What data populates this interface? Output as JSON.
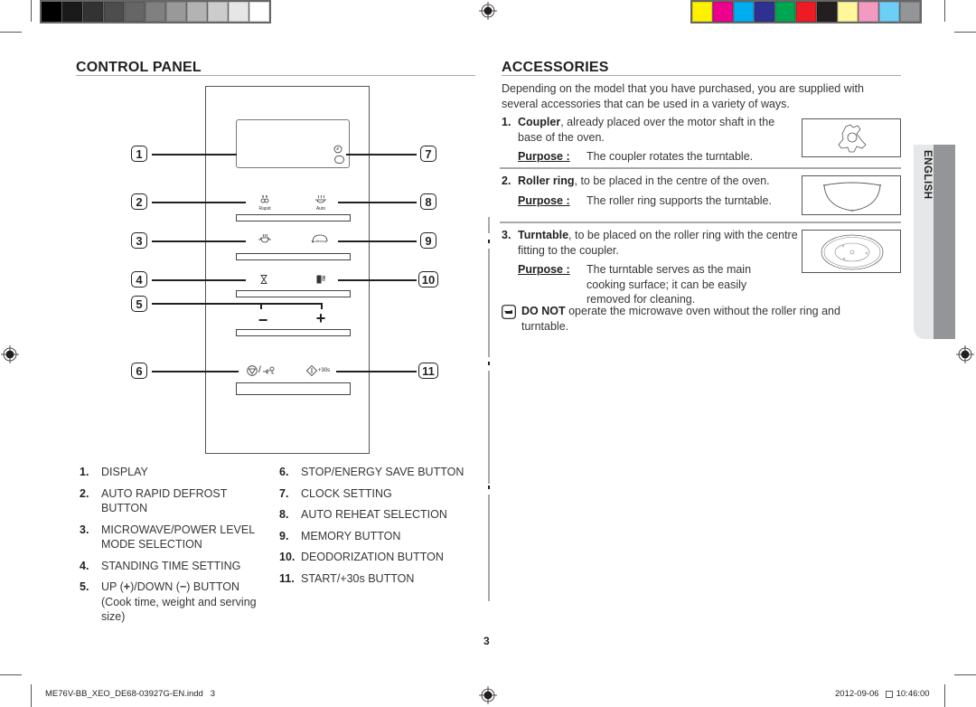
{
  "color_bars": {
    "grayscale": [
      "#000000",
      "#1a1a1a",
      "#333333",
      "#4d4d4d",
      "#666666",
      "#808080",
      "#999999",
      "#b3b3b3",
      "#cccccc",
      "#e6e6e6",
      "#ffffff"
    ],
    "process": [
      "#fff200",
      "#ec008c",
      "#00aeef",
      "#2e3192",
      "#00a651",
      "#ed1c24",
      "#231f20",
      "#fff799",
      "#f49ac1",
      "#6dcff6",
      "#939598"
    ]
  },
  "control_panel": {
    "title": "CONTROL PANEL",
    "callouts": [
      "1",
      "2",
      "3",
      "4",
      "5",
      "6",
      "7",
      "8",
      "9",
      "10",
      "11"
    ],
    "icons": {
      "rapid_label": "Rapid",
      "auto_label": "Auto",
      "memory_label": "Memory",
      "minus": "−",
      "plus": "+",
      "stop_separator": "/",
      "start_label": "+30s"
    },
    "legend_left": [
      {
        "num": "1.",
        "text": "DISPLAY"
      },
      {
        "num": "2.",
        "text": "AUTO RAPID DEFROST BUTTON"
      },
      {
        "num": "3.",
        "text": "MICROWAVE/POWER LEVEL MODE SELECTION"
      },
      {
        "num": "4.",
        "text": "STANDING TIME SETTING"
      },
      {
        "num": "5.",
        "text_before": "UP (",
        "plus": "+",
        "text_mid": ")/DOWN (",
        "minus": "−",
        "text_after": ") BUTTON (Cook time, weight and serving size)"
      }
    ],
    "legend_right": [
      {
        "num": "6.",
        "text": "STOP/ENERGY SAVE BUTTON"
      },
      {
        "num": "7.",
        "text": "CLOCK SETTING"
      },
      {
        "num": "8.",
        "text": "AUTO REHEAT SELECTION"
      },
      {
        "num": "9.",
        "text": "MEMORY BUTTON"
      },
      {
        "num": "10.",
        "text": "DEODORIZATION BUTTON"
      },
      {
        "num": "11.",
        "text": "START/+30s BUTTON"
      }
    ]
  },
  "accessories": {
    "title": "ACCESSORIES",
    "intro": "Depending on the model that you have purchased, you are supplied with several accessories that can be used in a variety of ways.",
    "purpose_label": "Purpose :",
    "items": [
      {
        "num": "1.",
        "name": "Coupler",
        "desc": ", already placed over the motor shaft in the base of the oven.",
        "purpose": "The coupler rotates the turntable."
      },
      {
        "num": "2.",
        "name": "Roller ring",
        "desc": ", to be placed in the centre of the oven.",
        "purpose": "The roller ring supports the turntable."
      },
      {
        "num": "3.",
        "name": "Turntable",
        "desc": ", to be placed on the roller ring with the centre fitting to the coupler.",
        "purpose": "The turntable serves as the main cooking surface; it can be easily removed for cleaning."
      }
    ],
    "note": {
      "bold": "DO NOT",
      "text": " operate the microwave oven without the roller ring and turntable."
    }
  },
  "side_tab": {
    "label": "ENGLISH"
  },
  "page_number": "3",
  "slug": {
    "file": "ME76V-BB_XEO_DE68-03927G-EN.indd   3",
    "date": "2012-09-06",
    "time": "10:46:00"
  }
}
